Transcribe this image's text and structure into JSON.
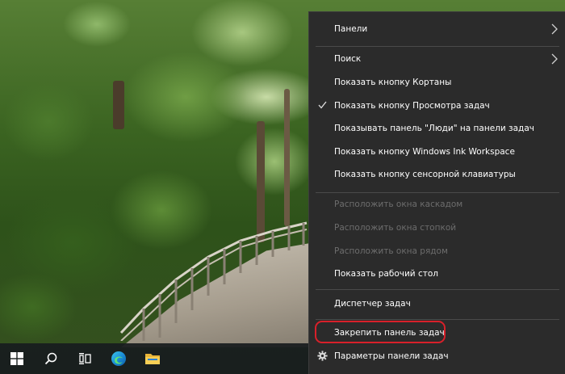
{
  "context_menu": {
    "items": [
      {
        "label": "Панели",
        "has_submenu": true,
        "enabled": true
      },
      {
        "label": "Поиск",
        "has_submenu": true,
        "enabled": true
      },
      {
        "label": "Показать кнопку Кортаны",
        "enabled": true
      },
      {
        "label": "Показать кнопку Просмотра задач",
        "checked": true,
        "enabled": true
      },
      {
        "label": "Показывать панель \"Люди\" на панели задач",
        "enabled": true
      },
      {
        "label": "Показать кнопку Windows Ink Workspace",
        "enabled": true
      },
      {
        "label": "Показать кнопку сенсорной клавиатуры",
        "enabled": true
      },
      {
        "label": "Расположить окна каскадом",
        "enabled": false
      },
      {
        "label": "Расположить окна стопкой",
        "enabled": false
      },
      {
        "label": "Расположить окна рядом",
        "enabled": false
      },
      {
        "label": "Показать рабочий стол",
        "enabled": true
      },
      {
        "label": "Диспетчер задач",
        "enabled": true
      },
      {
        "label": "Закрепить панель задач",
        "enabled": true,
        "highlighted": true
      },
      {
        "label": "Параметры панели задач",
        "icon": "gear-icon",
        "enabled": true
      }
    ]
  },
  "taskbar": {
    "buttons": [
      {
        "name": "start-button",
        "icon": "windows-logo-icon"
      },
      {
        "name": "search-button",
        "icon": "search-icon"
      },
      {
        "name": "task-view-button",
        "icon": "task-view-icon"
      },
      {
        "name": "edge-button",
        "icon": "edge-icon"
      },
      {
        "name": "file-explorer-button",
        "icon": "folder-icon"
      }
    ]
  },
  "colors": {
    "menu_bg": "#2b2b2b",
    "menu_text": "#ffffff",
    "menu_disabled_text": "#6d6d6d",
    "highlight_ring": "#d8202a",
    "taskbar_bg": "#181c1e"
  }
}
